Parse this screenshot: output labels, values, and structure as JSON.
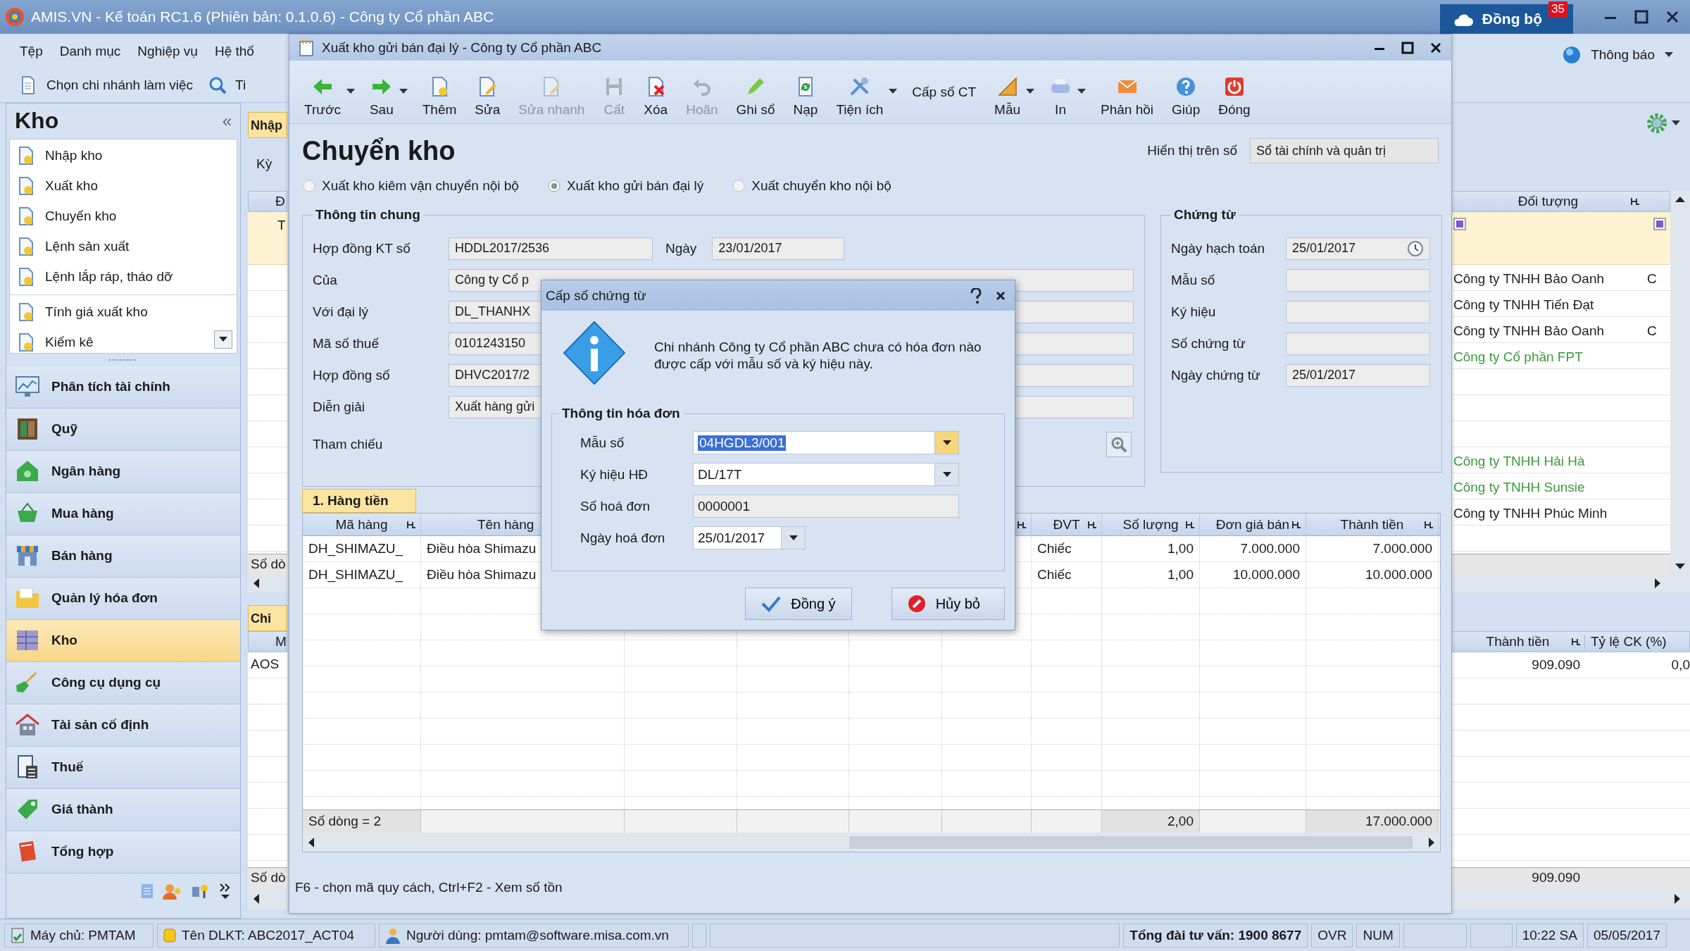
{
  "app": {
    "title": "AMIS.VN - Kế toán RC1.6 (Phiên bản: 0.1.0.6) - Công ty Cổ phần ABC",
    "sync_label": "Đồng bộ",
    "sync_badge": "35",
    "menu": [
      "Tệp",
      "Danh mục",
      "Nghiệp vụ",
      "Hệ thố"
    ],
    "branch_button": "Chọn chi nhánh làm việc",
    "search_stub": "Ti",
    "notifications": "Thông báo"
  },
  "sidebar": {
    "title": "Kho",
    "collapse": "«",
    "groups": [
      [
        "Nhập kho",
        "Xuất kho",
        "Chuyển kho",
        "Lệnh sản xuất",
        "Lệnh lắp ráp, tháo dỡ"
      ],
      [
        "Tính giá xuất kho",
        "Kiểm kê"
      ]
    ],
    "modules": [
      {
        "label": "Phân tích tài chính",
        "selected": false
      },
      {
        "label": "Quỹ",
        "selected": false
      },
      {
        "label": "Ngân hàng",
        "selected": false
      },
      {
        "label": "Mua hàng",
        "selected": false
      },
      {
        "label": "Bán hàng",
        "selected": false
      },
      {
        "label": "Quản lý hóa đơn",
        "selected": false
      },
      {
        "label": "Kho",
        "selected": true
      },
      {
        "label": "Công cụ dụng cụ",
        "selected": false
      },
      {
        "label": "Tài sản cố định",
        "selected": false
      },
      {
        "label": "Thuế",
        "selected": false
      },
      {
        "label": "Giá thành",
        "selected": false
      },
      {
        "label": "Tổng hợp",
        "selected": false
      }
    ]
  },
  "background": {
    "tab": "Nhập",
    "period_label": "Kỳ",
    "column": "Đ",
    "filter_text": "T",
    "footer": "Số dò",
    "tab_2": "Chi",
    "column_2": "M",
    "row_2": "AOS",
    "footer_2": "Số dò"
  },
  "right_pane": {
    "column": "Đối tượng",
    "rows_top": [
      {
        "name": "Công ty TNHH Bảo Oanh",
        "column_2": "C",
        "color": "#222222"
      },
      {
        "name": "Công ty TNHH Tiến Đạt",
        "color": "#222222"
      },
      {
        "name": "Công ty TNHH Bảo Oanh",
        "column_2": "C",
        "color": "#222222"
      },
      {
        "name": "Công ty Cổ phần FPT",
        "color": "#3a9a3a"
      }
    ],
    "rows_bottom": [
      {
        "name": "Công ty TNHH Hải Hà",
        "color": "#3a9a3a"
      },
      {
        "name": "Công ty TNHH Sunsie",
        "color": "#3a9a3a"
      },
      {
        "name": "Công ty TNHH Phúc Minh",
        "color": "#222222"
      }
    ],
    "lower_columns": [
      "Thành tiền",
      "Tỷ lệ CK (%)"
    ],
    "lower_row": [
      "909.090",
      "0,0"
    ],
    "lower_total": "909.090"
  },
  "form_window": {
    "title": "Xuất kho gửi bán đại lý - Công ty Cổ phần ABC",
    "toolbar": [
      {
        "label": "Trước",
        "dropdown": true,
        "disabled": false
      },
      {
        "label": "Sau",
        "dropdown": true,
        "disabled": false
      },
      {
        "label": "Thêm",
        "dropdown": false,
        "disabled": false
      },
      {
        "label": "Sửa",
        "dropdown": false,
        "disabled": false
      },
      {
        "label": "Sửa nhanh",
        "dropdown": false,
        "disabled": true
      },
      {
        "label": "Cất",
        "dropdown": false,
        "disabled": true
      },
      {
        "label": "Xóa",
        "dropdown": false,
        "disabled": false
      },
      {
        "label": "Hoãn",
        "dropdown": false,
        "disabled": true
      },
      {
        "label": "Ghi sổ",
        "dropdown": false,
        "disabled": false
      },
      {
        "label": "Nạp",
        "dropdown": false,
        "disabled": false
      },
      {
        "label": "Tiện ích",
        "dropdown": true,
        "disabled": false
      },
      {
        "label": "Cấp số CT",
        "dropdown": false,
        "disabled": false
      },
      {
        "label": "Mẫu",
        "dropdown": true,
        "disabled": false
      },
      {
        "label": "In",
        "dropdown": true,
        "disabled": false
      },
      {
        "label": "Phản hồi",
        "dropdown": false,
        "disabled": false
      },
      {
        "label": "Giúp",
        "dropdown": false,
        "disabled": false
      },
      {
        "label": "Đóng",
        "dropdown": false,
        "disabled": false
      }
    ],
    "heading": "Chuyển kho",
    "display_label": "Hiển thị trên số",
    "display_value": "Sổ tài chính và quản trị",
    "options": [
      {
        "label": "Xuất kho kiêm vận chuyển nội bộ",
        "selected": false
      },
      {
        "label": "Xuất kho gửi bán đại lý",
        "selected": true
      },
      {
        "label": "Xuất chuyển kho nội bộ",
        "selected": false
      }
    ],
    "general": {
      "title": "Thông tin chung",
      "contract_label": "Hợp đồng KT số",
      "contract_value": "HDDL2017/2536",
      "date_label": "Ngày",
      "date_value": "23/01/2017",
      "fields": [
        {
          "label": "Của",
          "value": "Công ty Cổ p"
        },
        {
          "label": "Với đại lý",
          "value": "DL_THANHX"
        },
        {
          "label": "Mã số thuế",
          "value": "0101243150"
        },
        {
          "label": "Hợp đồng số",
          "value": "DHVC2017/2"
        },
        {
          "label": "Diễn giải",
          "value": "Xuất hàng gửi"
        }
      ],
      "reference_label": "Tham chiếu"
    },
    "voucher": {
      "title": "Chứng từ",
      "fields": [
        {
          "label": "Ngày hạch toán",
          "value": "25/01/2017"
        },
        {
          "label": "Mẫu số"
        },
        {
          "label": "Ký hiệu"
        },
        {
          "label": "Số chứng từ"
        },
        {
          "label": "Ngày chứng từ",
          "value": "25/01/2017"
        }
      ]
    },
    "tab": "1. Hàng tiền",
    "grid": {
      "columns": [
        "Mã hàng",
        "Tên hàng",
        "ĐVT",
        "Số lượng",
        "Đơn giá bán",
        "Thành tiền"
      ],
      "rows": [
        {
          "code": "DH_SHIMAZU_",
          "name": "Điều hòa Shimazu",
          "unit": "Chiếc",
          "quantity": "1,00",
          "price": "7.000.000",
          "amount": "7.000.000"
        },
        {
          "code": "DH_SHIMAZU_",
          "name": "Điều hòa Shimazu",
          "unit": "Chiếc",
          "quantity": "1,00",
          "price": "10.000.000",
          "amount": "10.000.000"
        }
      ],
      "footer": {
        "count": "Số dòng = 2",
        "quantity": "2,00",
        "amount": "17.000.000"
      }
    },
    "hint": "F6 - chọn mã quy cách, Ctrl+F2 - Xem số tồn"
  },
  "dialog": {
    "title": "Cấp số chứng từ",
    "message": "Chi nhánh Công ty Cổ phần ABC chưa có hóa đơn nào được cấp với mẫu số và ký hiệu này.",
    "group_title": "Thông tin hóa đơn",
    "fields": [
      {
        "label": "Mẫu số",
        "value": "04HGDL3/001",
        "kind": "combo",
        "text_selected": true
      },
      {
        "label": "Ký hiệu HĐ",
        "value": "DL/17T",
        "kind": "combo",
        "text_selected": false
      },
      {
        "label": "Số hoá đơn",
        "value": "0000001",
        "kind": "text",
        "text_selected": false
      },
      {
        "label": "Ngày hoá đơn",
        "value": "25/01/2017",
        "kind": "date",
        "text_selected": false
      }
    ],
    "ok": "Đồng ý",
    "cancel": "Hủy bỏ"
  },
  "status_bar": {
    "server": "Máy chủ: PMTAM",
    "database": "Tên DLKT: ABC2017_ACT04",
    "user": "Người dùng: pmtam@software.misa.com.vn",
    "hotline": "Tổng đài tư vấn: 1900 8677",
    "ovr": "OVR",
    "num": "NUM",
    "time": "10:22 SA",
    "date": "05/05/2017"
  }
}
